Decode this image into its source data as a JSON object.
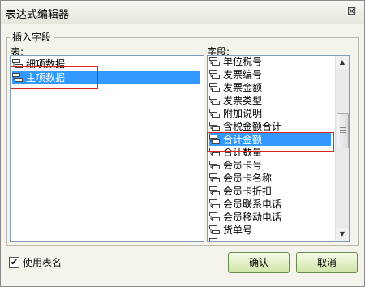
{
  "window": {
    "title": "表达式编辑器",
    "close_glyph": "⊠"
  },
  "group": {
    "label": "插入字段"
  },
  "tables": {
    "label": "表:",
    "items": [
      "细项数据",
      "主项数据"
    ],
    "selected_index": 1
  },
  "fields": {
    "label": "字段:",
    "items": [
      "单位税号",
      "发票编号",
      "发票金额",
      "发票类型",
      "附加说明",
      "含税金额合计",
      "合计金额",
      "合计数量",
      "会员卡号",
      "会员卡名称",
      "会员卡折扣",
      "会员联系电话",
      "会员移动电话",
      "货单号",
      "…"
    ],
    "selected_index": 6
  },
  "options": {
    "use_table_name_label": "使用表名",
    "use_table_name_checked": true,
    "check_glyph": "✔"
  },
  "buttons": {
    "ok": "确认",
    "cancel": "取消"
  },
  "scroll": {
    "up_glyph": "▲",
    "down_glyph": "▼"
  },
  "colors": {
    "selection": "#3399ff",
    "highlight_box": "#d9251d",
    "button_green": "#cfe5a8"
  }
}
